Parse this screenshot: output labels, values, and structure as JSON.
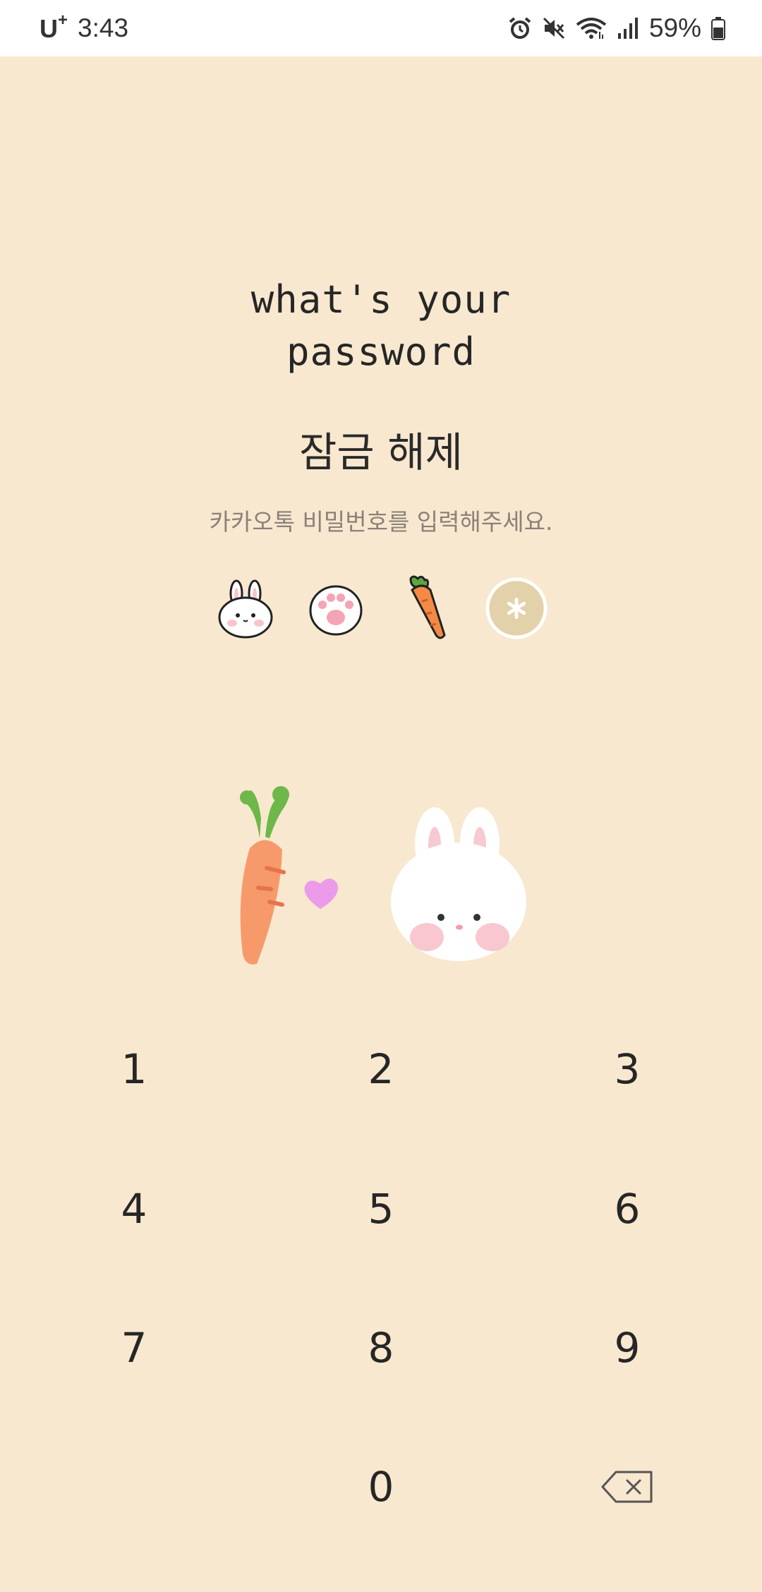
{
  "status_bar": {
    "carrier": "U",
    "carrier_plus": "+",
    "time": "3:43",
    "battery": "59%",
    "icons": [
      "alarm-icon",
      "mute-icon",
      "wifi-icon",
      "signal-icon",
      "battery-icon"
    ]
  },
  "headline": {
    "line1": "what's your",
    "line2": "password"
  },
  "title": "잠금 해제",
  "subtitle": "카카오톡 비밀번호를 입력해주세요.",
  "pin_dots": [
    "bunny-face-icon",
    "paw-icon",
    "carrot-icon",
    "empty-slot-icon"
  ],
  "illustration": [
    "carrot-icon",
    "heart-icon",
    "bunny-icon"
  ],
  "keypad": {
    "keys": [
      "1",
      "2",
      "3",
      "4",
      "5",
      "6",
      "7",
      "8",
      "9",
      "0"
    ],
    "backspace_icon": "backspace-icon"
  },
  "colors": {
    "background": "#F8E8CF",
    "status_bar": "#FFFFFF",
    "text": "#262626",
    "subtitle": "#8A8179",
    "carrot": "#F79A6B",
    "leaf": "#6DB848",
    "heart": "#EC9BEA"
  }
}
